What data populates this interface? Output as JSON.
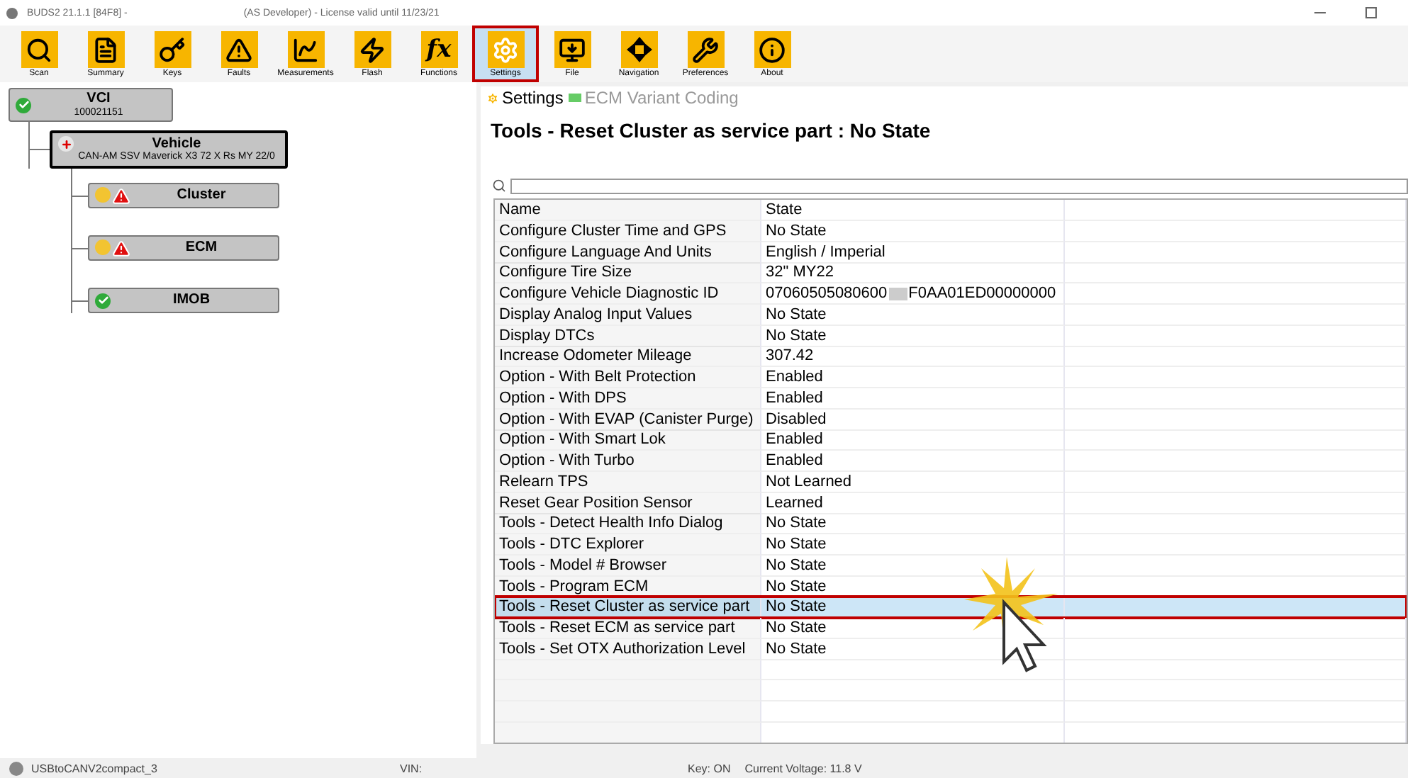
{
  "window": {
    "title": "BUDS2  21.1.1 [84F8] -",
    "license": "(AS Developer)  - License valid until 11/23/21"
  },
  "toolbar": [
    {
      "label": "Scan",
      "kind": "scan",
      "selected": false
    },
    {
      "label": "Summary",
      "kind": "summary",
      "selected": false
    },
    {
      "label": "Keys",
      "kind": "key",
      "selected": false
    },
    {
      "label": "Faults",
      "kind": "warning",
      "selected": false
    },
    {
      "label": "Measurements",
      "kind": "chart",
      "selected": false
    },
    {
      "label": "Flash",
      "kind": "flash",
      "selected": false
    },
    {
      "label": "Functions",
      "kind": "text",
      "icon_text": "fx",
      "selected": false
    },
    {
      "label": "Settings",
      "kind": "gear",
      "selected": true
    },
    {
      "label": "File",
      "kind": "monitor",
      "selected": false
    },
    {
      "label": "Navigation",
      "kind": "arrows",
      "selected": false
    },
    {
      "label": "Preferences",
      "kind": "tools",
      "selected": false
    },
    {
      "label": "About",
      "kind": "info",
      "selected": false
    }
  ],
  "tree": {
    "title": "VCI",
    "subtitle": "100021151",
    "kind": "ok",
    "children": [
      {
        "title": "Vehicle",
        "subtitle": "CAN-AM SSV Maverick X3 72 X Rs MY 22/0",
        "kind": "vehicle",
        "selected": true,
        "children": [
          {
            "title": "Cluster",
            "kind": "warning",
            "selected": false
          },
          {
            "title": "ECM",
            "kind": "warning",
            "selected": false
          },
          {
            "title": "IMOB",
            "kind": "ok",
            "selected": false
          }
        ]
      }
    ]
  },
  "tabs": [
    {
      "label": "Settings",
      "selected": true
    },
    {
      "label": "ECM Variant Coding",
      "selected": false
    }
  ],
  "heading": "Tools - Reset Cluster as service part : No State",
  "table": {
    "columns": [
      "Name",
      "State"
    ],
    "rows": [
      {
        "name": "Configure Cluster Time and GPS",
        "state": "No State",
        "selected": false
      },
      {
        "name": "Configure Language And Units",
        "state": "English / Imperial",
        "selected": false
      },
      {
        "name": "Configure Tire Size",
        "state": "32\" MY22",
        "selected": false
      },
      {
        "name": "Configure Vehicle Diagnostic ID",
        "state": "07060505080600",
        "state_after_redaction": "F0AA01ED00000000",
        "selected": false
      },
      {
        "name": "Display Analog Input Values",
        "state": "No State",
        "selected": false
      },
      {
        "name": "Display DTCs",
        "state": "No State",
        "selected": false
      },
      {
        "name": "Increase Odometer Mileage",
        "state": "307.42",
        "selected": false
      },
      {
        "name": "Option - With Belt Protection",
        "state": "Enabled",
        "selected": false
      },
      {
        "name": "Option - With DPS",
        "state": "Enabled",
        "selected": false
      },
      {
        "name": "Option - With EVAP (Canister Purge)",
        "state": "Disabled",
        "selected": false
      },
      {
        "name": "Option - With Smart Lok",
        "state": "Enabled",
        "selected": false
      },
      {
        "name": "Option - With Turbo",
        "state": "Enabled",
        "selected": false
      },
      {
        "name": "Relearn TPS",
        "state": "Not Learned",
        "selected": false
      },
      {
        "name": "Reset Gear Position Sensor",
        "state": "Learned",
        "selected": false
      },
      {
        "name": "Tools - Detect Health Info Dialog",
        "state": "No State",
        "selected": false
      },
      {
        "name": "Tools - DTC Explorer",
        "state": "No State",
        "selected": false
      },
      {
        "name": "Tools - Model # Browser",
        "state": "No State",
        "selected": false
      },
      {
        "name": "Tools - Program ECM",
        "state": "No State",
        "selected": false
      },
      {
        "name": "Tools - Reset Cluster as service part",
        "state": "No State",
        "selected": true
      },
      {
        "name": "Tools - Reset ECM as service part",
        "state": "No State",
        "selected": false
      },
      {
        "name": "Tools - Set OTX Authorization Level",
        "state": "No State",
        "selected": false
      }
    ]
  },
  "status_bar": {
    "adapter": "USBtoCANV2compact_3",
    "vin": "VIN:",
    "key": "Key: ON",
    "voltage": "Current Voltage: 11.8 V"
  }
}
